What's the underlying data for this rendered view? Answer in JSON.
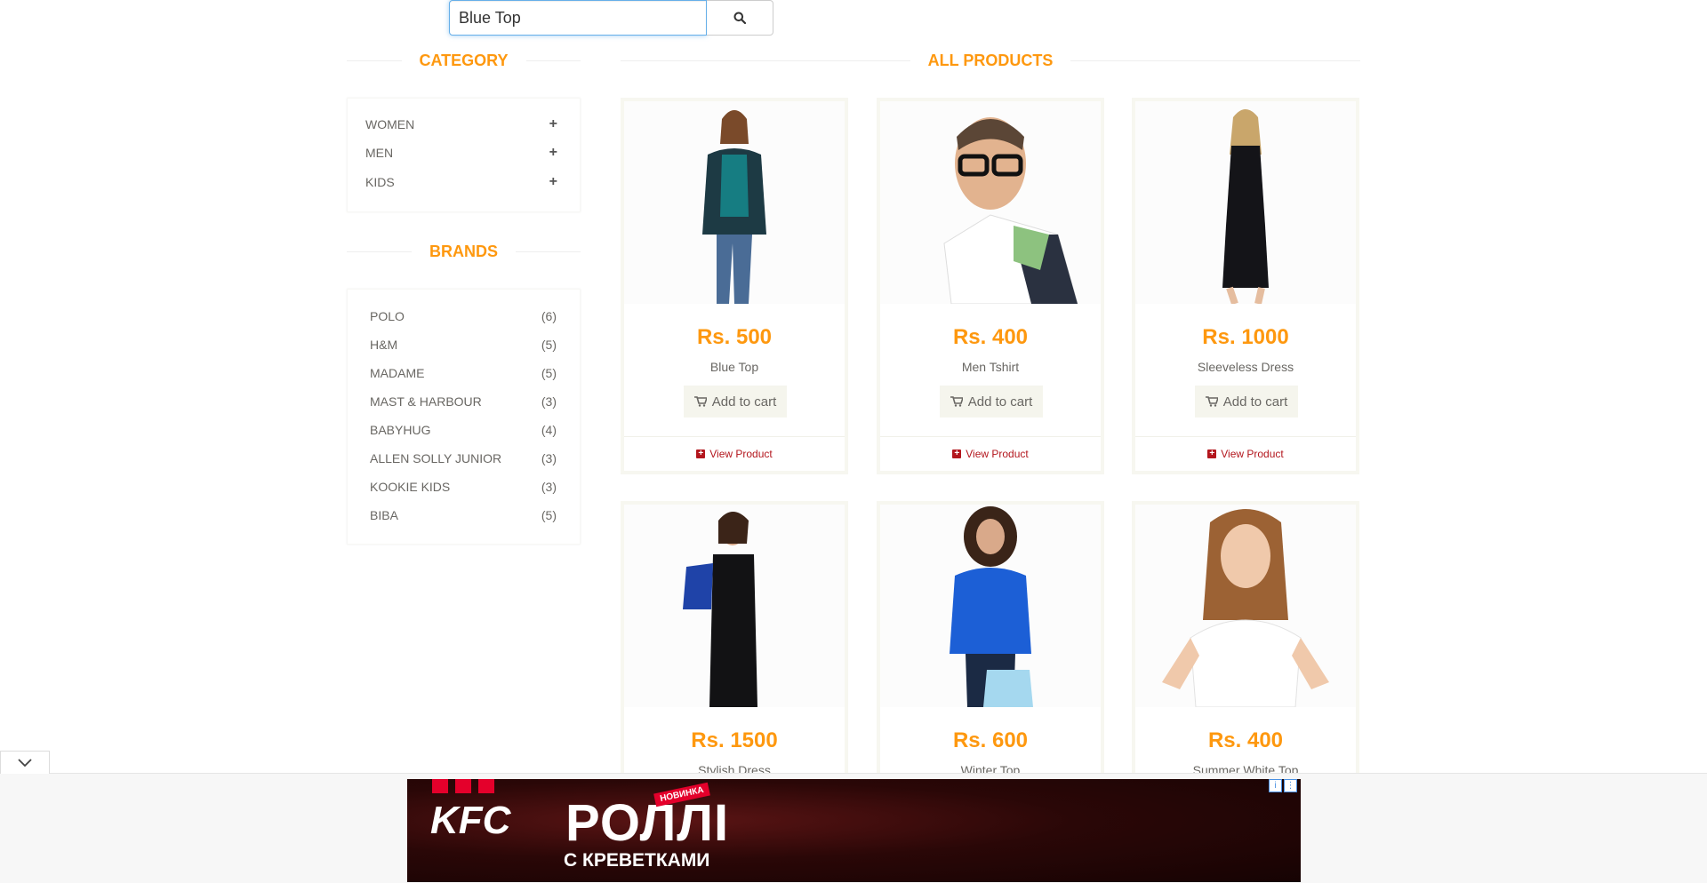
{
  "search": {
    "value": "Blue Top",
    "button_icon": "search-icon"
  },
  "category": {
    "title": "CATEGORY",
    "items": [
      {
        "label": "WOMEN",
        "icon": "plus-icon"
      },
      {
        "label": "MEN",
        "icon": "plus-icon"
      },
      {
        "label": "KIDS",
        "icon": "plus-icon"
      }
    ]
  },
  "brands": {
    "title": "BRANDS",
    "items": [
      {
        "name": "POLO",
        "count": "(6)"
      },
      {
        "name": "H&M",
        "count": "(5)"
      },
      {
        "name": "MADAME",
        "count": "(5)"
      },
      {
        "name": "MAST & HARBOUR",
        "count": "(3)"
      },
      {
        "name": "BABYHUG",
        "count": "(4)"
      },
      {
        "name": "ALLEN SOLLY JUNIOR",
        "count": "(3)"
      },
      {
        "name": "KOOKIE KIDS",
        "count": "(3)"
      },
      {
        "name": "BIBA",
        "count": "(5)"
      }
    ]
  },
  "products": {
    "title": "ALL PRODUCTS",
    "add_to_cart_label": "Add to cart",
    "view_product_label": "View Product",
    "items": [
      {
        "price": "Rs. 500",
        "name": "Blue Top"
      },
      {
        "price": "Rs. 400",
        "name": "Men Tshirt"
      },
      {
        "price": "Rs. 1000",
        "name": "Sleeveless Dress"
      },
      {
        "price": "Rs. 1500",
        "name": "Stylish Dress"
      },
      {
        "price": "Rs. 600",
        "name": "Winter Top"
      },
      {
        "price": "Rs. 400",
        "name": "Summer White Top"
      }
    ]
  },
  "ad": {
    "brand": "KFC",
    "headline": "РОЛЛІ",
    "sub": "С КРЕВЕТКАМИ",
    "badge": "НОВИНКА",
    "colors": {
      "accent": "#FE980F",
      "link": "#B3161D",
      "ad_red": "#e4002b"
    }
  }
}
